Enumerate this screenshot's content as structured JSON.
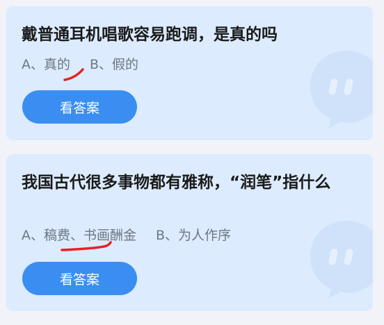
{
  "cards": [
    {
      "question": "戴普通耳机唱歌容易跑调，是真的吗",
      "option_a": "A、真的",
      "option_b": "B、假的",
      "button_label": "看答案"
    },
    {
      "question": "我国古代很多事物都有雅称，“润笔”指什么",
      "option_a": "A、稿费、书画酬金",
      "option_b": "B、为人作序",
      "button_label": "看答案"
    }
  ],
  "icons": {
    "decoration": "chat-bubble-icon",
    "handwritten_mark": "red-pen-underline"
  },
  "colors": {
    "card_background": "#dcebfd",
    "button": "#3a8ef2",
    "question_text": "#1a1a1a",
    "option_text": "#6d7784",
    "pen_mark": "#e8201f"
  }
}
